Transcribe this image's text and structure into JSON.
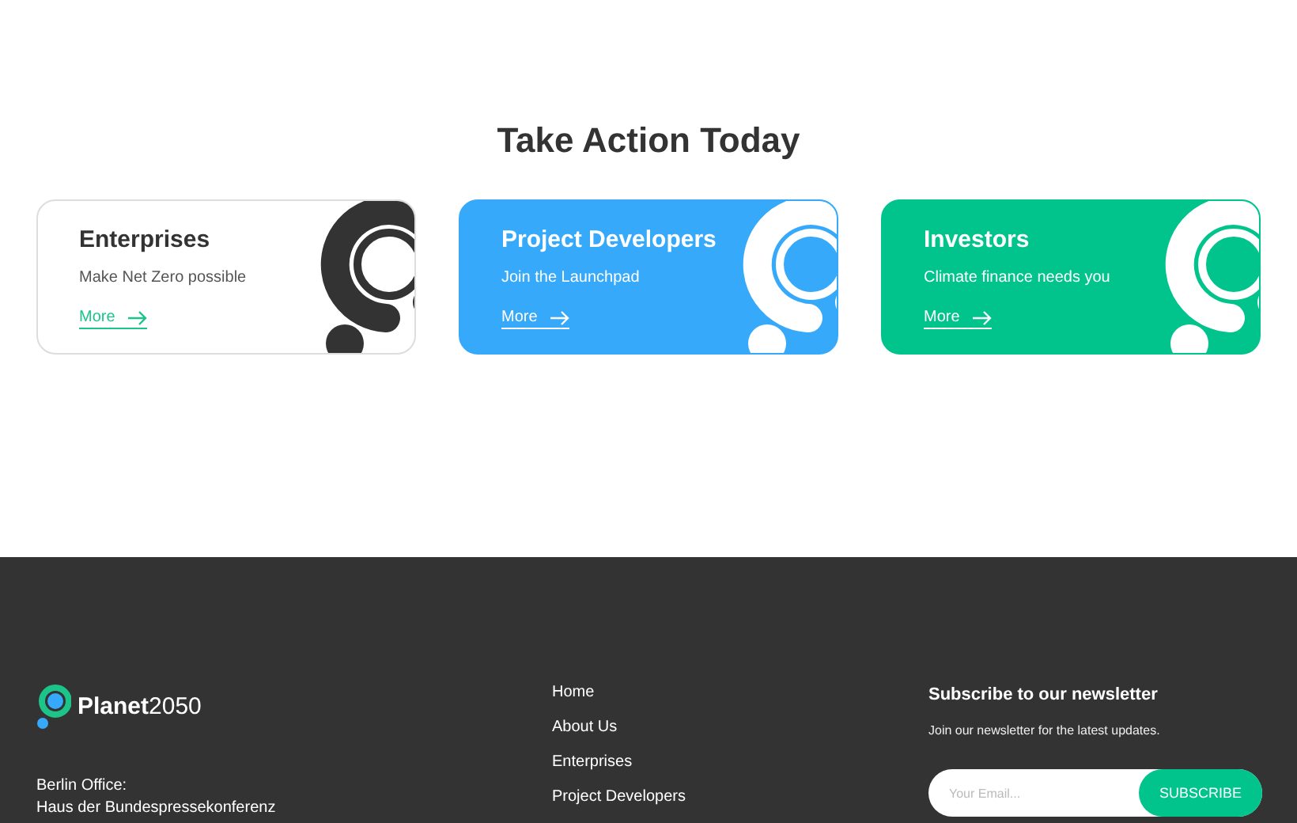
{
  "section": {
    "title": "Take Action Today"
  },
  "cards": [
    {
      "kind": "outline",
      "color": "#ffffff",
      "title": "Enterprises",
      "subtitle": "Make Net Zero possible",
      "link": "More"
    },
    {
      "kind": "filled",
      "color": "#36a9fb",
      "title": "Project Developers",
      "subtitle": "Join the Launchpad",
      "link": "More"
    },
    {
      "kind": "filled",
      "color": "#00c48c",
      "title": "Investors",
      "subtitle": "Climate finance needs you",
      "link": "More"
    }
  ],
  "footer": {
    "logo": {
      "strong": "Planet",
      "light": "2050"
    },
    "address": [
      "Berlin Office:",
      "Haus der Bundespressekonferenz"
    ],
    "nav": [
      "Home",
      "About Us",
      "Enterprises",
      "Project Developers"
    ],
    "newsletter": {
      "title": "Subscribe to our newsletter",
      "text": "Join our newsletter for the latest updates.",
      "placeholder": "Your Email...",
      "button": "SUBSCRIBE"
    }
  }
}
